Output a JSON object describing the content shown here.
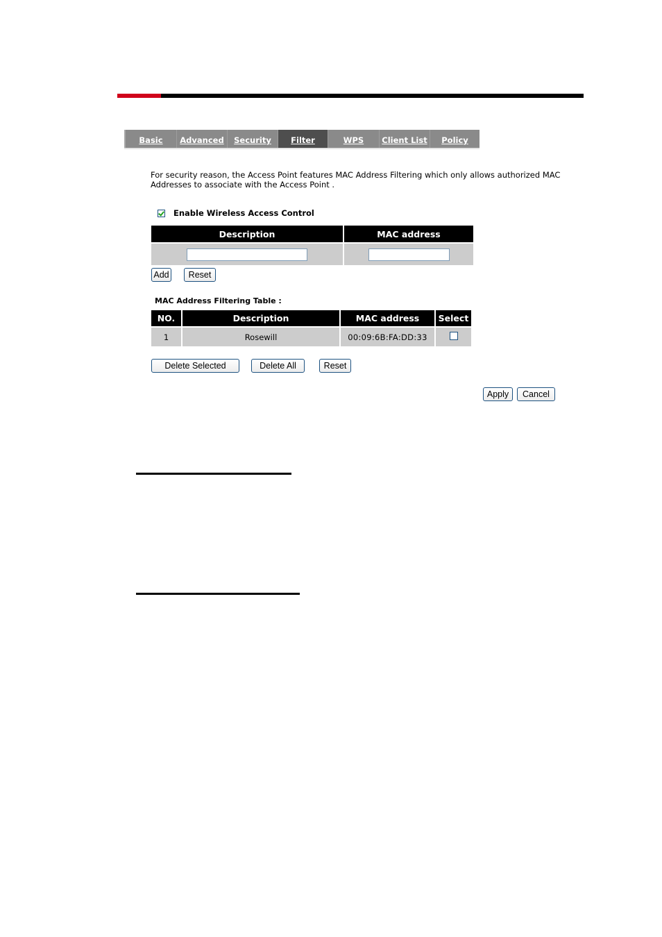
{
  "tabs": [
    {
      "label": "Basic",
      "active": false
    },
    {
      "label": "Advanced",
      "active": false
    },
    {
      "label": "Security",
      "active": false
    },
    {
      "label": "Filter",
      "active": true
    },
    {
      "label": "WPS",
      "active": false
    },
    {
      "label": "Client List",
      "active": false
    },
    {
      "label": "Policy",
      "active": false
    }
  ],
  "intro_text": "For security reason, the Access Point features MAC Address Filtering which only allows authorized MAC Addresses to associate with the Access Point .",
  "enable_control": {
    "label": "Enable Wireless Access Control",
    "checked": true
  },
  "add_form": {
    "headers": {
      "description": "Description",
      "mac": "MAC address"
    },
    "description_value": "",
    "mac_value": "",
    "add_label": "Add",
    "reset_label": "Reset"
  },
  "filter_table": {
    "title": "MAC Address Filtering Table :",
    "headers": {
      "no": "NO.",
      "description": "Description",
      "mac": "MAC address",
      "select": "Select"
    },
    "rows": [
      {
        "no": "1",
        "description": "Rosewill",
        "mac": "00:09:6B:FA:DD:33",
        "selected": false
      }
    ],
    "delete_selected_label": "Delete Selected",
    "delete_all_label": "Delete All",
    "reset_label": "Reset"
  },
  "footer": {
    "apply_label": "Apply",
    "cancel_label": "Cancel"
  },
  "colors": {
    "accent": "#d0021b",
    "tab_bg": "#8a8a8a",
    "tab_active_bg": "#4e4e4e",
    "table_header_bg": "#000000",
    "table_cell_bg": "#cccccc"
  }
}
